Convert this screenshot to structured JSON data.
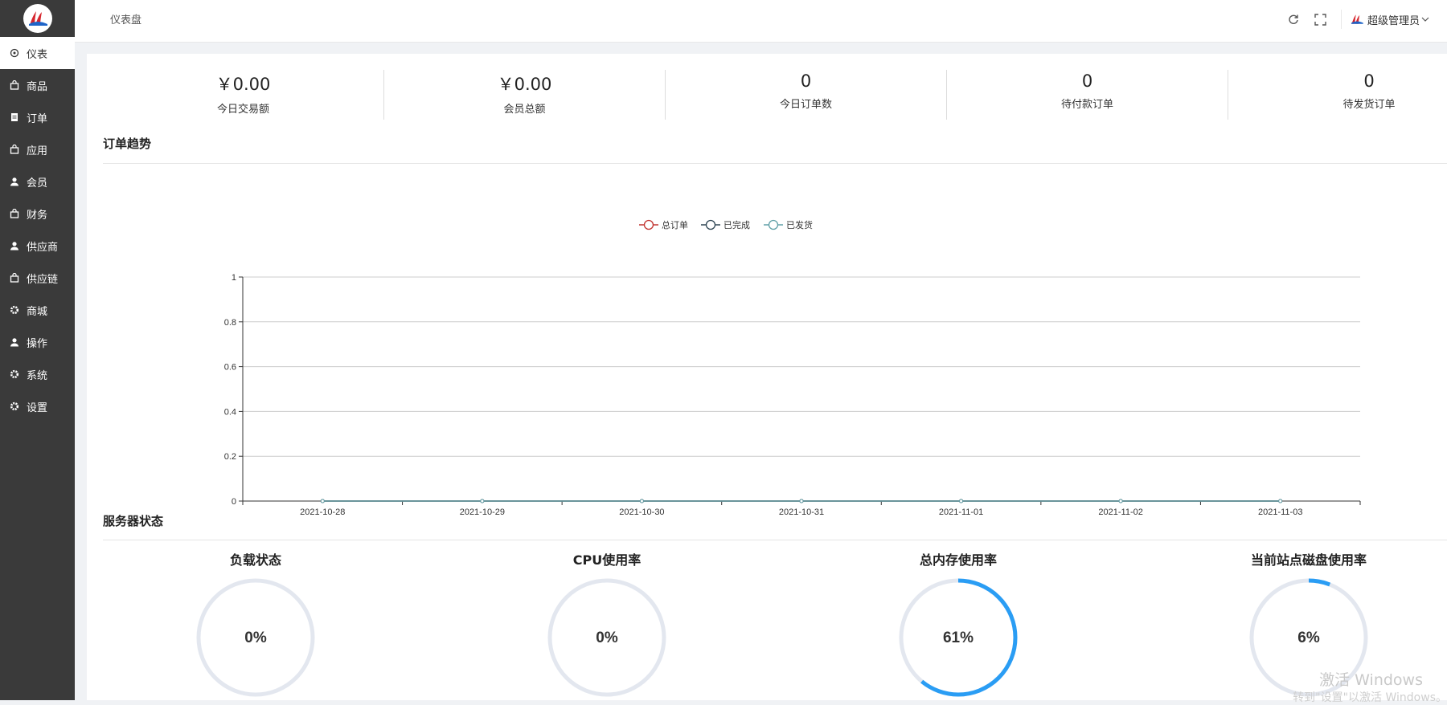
{
  "sidebar": {
    "items": [
      {
        "label": "仪表",
        "icon": "dashboard-icon",
        "active": true
      },
      {
        "label": "商品",
        "icon": "bag-icon"
      },
      {
        "label": "订单",
        "icon": "document-icon"
      },
      {
        "label": "应用",
        "icon": "bag-icon"
      },
      {
        "label": "会员",
        "icon": "user-icon"
      },
      {
        "label": "财务",
        "icon": "bag-icon"
      },
      {
        "label": "供应商",
        "icon": "user-icon"
      },
      {
        "label": "供应链",
        "icon": "bag-icon"
      },
      {
        "label": "商城",
        "icon": "gear-icon"
      },
      {
        "label": "操作",
        "icon": "user-icon"
      },
      {
        "label": "系统",
        "icon": "gear-icon"
      },
      {
        "label": "设置",
        "icon": "gear-icon"
      }
    ]
  },
  "header": {
    "breadcrumb": "仪表盘",
    "user_name": "超级管理员"
  },
  "stats": [
    {
      "value": "￥0.00",
      "label": "今日交易额"
    },
    {
      "value": "￥0.00",
      "label": "会员总额"
    },
    {
      "value": "0",
      "label": "今日订单数"
    },
    {
      "value": "0",
      "label": "待付款订单"
    },
    {
      "value": "0",
      "label": "待发货订单"
    }
  ],
  "sections": {
    "order_trend": "订单趋势",
    "server_status": "服务器状态"
  },
  "chart_data": {
    "type": "line",
    "x": [
      "2021-10-28",
      "2021-10-29",
      "2021-10-30",
      "2021-10-31",
      "2021-11-01",
      "2021-11-02",
      "2021-11-03"
    ],
    "series": [
      {
        "name": "总订单",
        "values": [
          0,
          0,
          0,
          0,
          0,
          0,
          0
        ],
        "color": "#c23531"
      },
      {
        "name": "已完成",
        "values": [
          0,
          0,
          0,
          0,
          0,
          0,
          0
        ],
        "color": "#2f4554"
      },
      {
        "name": "已发货",
        "values": [
          0,
          0,
          0,
          0,
          0,
          0,
          0
        ],
        "color": "#61a0a8"
      }
    ],
    "ylim": [
      0,
      1
    ],
    "yticks": [
      "0",
      "0.2",
      "0.4",
      "0.6",
      "0.8",
      "1"
    ],
    "legend": "top-center",
    "grid": true
  },
  "gauges": [
    {
      "title": "负载状态",
      "value": 0,
      "label": "0%"
    },
    {
      "title": "CPU使用率",
      "value": 0,
      "label": "0%"
    },
    {
      "title": "总内存使用率",
      "value": 61,
      "label": "61%"
    },
    {
      "title": "当前站点磁盘使用率",
      "value": 6,
      "label": "6%"
    }
  ],
  "colors": {
    "sidebar_bg": "#3a3a3a",
    "gauge_track": "#e3e7ef",
    "gauge_fill": "#2a9df4"
  },
  "watermark": {
    "line1": "激活 Windows",
    "line2": "转到\"设置\"以激活 Windows。"
  }
}
